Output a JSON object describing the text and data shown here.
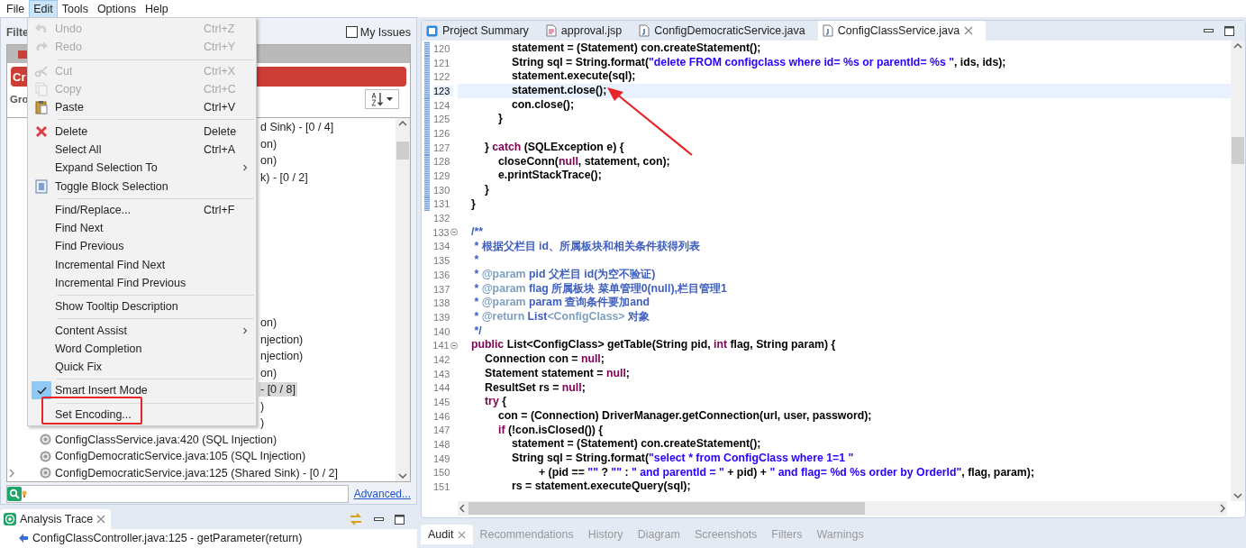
{
  "menubar": [
    {
      "label": "File",
      "selected": false
    },
    {
      "label": "Edit",
      "selected": true
    },
    {
      "label": "Tools",
      "selected": false
    },
    {
      "label": "Options",
      "selected": false
    },
    {
      "label": "Help",
      "selected": false
    }
  ],
  "menu": {
    "items": [
      {
        "kind": "undo",
        "label": "Undo",
        "shortcut": "Ctrl+Z",
        "submenu": false,
        "disabled": true,
        "checked": false
      },
      {
        "kind": "redo",
        "label": "Redo",
        "shortcut": "Ctrl+Y",
        "submenu": false,
        "disabled": true,
        "checked": false
      },
      {
        "kind": "separator"
      },
      {
        "kind": "cut",
        "label": "Cut",
        "shortcut": "Ctrl+X",
        "submenu": false,
        "disabled": true,
        "checked": false
      },
      {
        "kind": "copy",
        "label": "Copy",
        "shortcut": "Ctrl+C",
        "submenu": false,
        "disabled": true,
        "checked": false
      },
      {
        "kind": "paste",
        "label": "Paste",
        "shortcut": "Ctrl+V",
        "submenu": false,
        "disabled": false,
        "checked": false
      },
      {
        "kind": "separator"
      },
      {
        "kind": "delete",
        "label": "Delete",
        "shortcut": "Delete",
        "submenu": false,
        "disabled": false,
        "checked": false
      },
      {
        "kind": "plain",
        "label": "Select All",
        "shortcut": "Ctrl+A",
        "submenu": false,
        "disabled": false,
        "checked": false
      },
      {
        "kind": "plain",
        "label": "Expand Selection To",
        "submenu": true,
        "disabled": false,
        "checked": false
      },
      {
        "kind": "block",
        "label": "Toggle Block Selection",
        "submenu": false,
        "disabled": false,
        "checked": false
      },
      {
        "kind": "separator"
      },
      {
        "kind": "plain",
        "label": "Find/Replace...",
        "shortcut": "Ctrl+F",
        "submenu": false,
        "disabled": false,
        "checked": false
      },
      {
        "kind": "plain",
        "label": "Find Next",
        "submenu": false,
        "disabled": false,
        "checked": false
      },
      {
        "kind": "plain",
        "label": "Find Previous",
        "submenu": false,
        "disabled": false,
        "checked": false
      },
      {
        "kind": "plain",
        "label": "Incremental Find Next",
        "submenu": false,
        "disabled": false,
        "checked": false
      },
      {
        "kind": "plain",
        "label": "Incremental Find Previous",
        "submenu": false,
        "disabled": false,
        "checked": false
      },
      {
        "kind": "separator"
      },
      {
        "kind": "plain",
        "label": "Show Tooltip Description",
        "submenu": false,
        "disabled": false,
        "checked": false
      },
      {
        "kind": "separator"
      },
      {
        "kind": "plain",
        "label": "Content Assist",
        "submenu": true,
        "disabled": false,
        "checked": false
      },
      {
        "kind": "plain",
        "label": "Word Completion",
        "submenu": false,
        "disabled": false,
        "checked": false
      },
      {
        "kind": "plain",
        "label": "Quick Fix",
        "submenu": false,
        "disabled": false,
        "checked": false
      },
      {
        "kind": "separator"
      },
      {
        "kind": "plain",
        "label": "Smart Insert Mode",
        "submenu": false,
        "disabled": false,
        "checked": true
      },
      {
        "kind": "separator"
      },
      {
        "kind": "plain",
        "label": "Set Encoding...",
        "submenu": false,
        "disabled": false,
        "checked": false
      }
    ]
  },
  "issues_panel": {
    "filter_label": "Filte",
    "my_issues": {
      "label": "My Issues",
      "checked": false
    },
    "category_label": "Cr",
    "group_label": "Gro",
    "row_fragments": [
      {
        "text": "d Sink) - [0 / 4]",
        "selected": false
      },
      {
        "text": "on)",
        "selected": false
      },
      {
        "text": "on)",
        "selected": false
      },
      {
        "text": "k) - [0 / 2]",
        "selected": false
      },
      {
        "text": "on)",
        "selected": false
      },
      {
        "text": "njection)",
        "selected": false
      },
      {
        "text": "njection)",
        "selected": false
      },
      {
        "text": "on)",
        "selected": false
      },
      {
        "text": "- [0 / 8]",
        "selected": true
      },
      {
        "text": ")",
        "selected": false
      },
      {
        "text": ")",
        "selected": false
      }
    ],
    "rows": [
      {
        "text": "ConfigClassService.java:420 (SQL Injection)",
        "selected": false,
        "expandable": false
      },
      {
        "text": "ConfigDemocraticService.java:105 (SQL Injection)",
        "selected": false,
        "expandable": false
      },
      {
        "text": "ConfigDemocraticService.java:125 (Shared Sink) - [0 / 2]",
        "selected": false,
        "expandable": true
      }
    ],
    "advanced_link": "Advanced..."
  },
  "analysis_trace": {
    "title": "Analysis Trace",
    "rows": [
      "ConfigClassController.java:125 - getParameter(return)"
    ]
  },
  "editor": {
    "tabs": [
      {
        "kind": "summary",
        "label": "Project Summary",
        "selected": false
      },
      {
        "kind": "jsp",
        "label": "approval.jsp",
        "selected": false
      },
      {
        "kind": "java",
        "label": "ConfigDemocraticService.java",
        "selected": false
      },
      {
        "kind": "java",
        "label": "ConfigClassService.java",
        "selected": true
      }
    ],
    "lines": [
      {
        "number": "120",
        "changed": true,
        "current": false,
        "foldable": false,
        "segments": [
          {
            "kind": "code",
            "text": "\t\t\tstatement = (Statement) con.createStatement();"
          }
        ]
      },
      {
        "number": "121",
        "changed": true,
        "current": false,
        "foldable": false,
        "segments": [
          {
            "kind": "code",
            "text": "\t\t\tString sql = String.format("
          },
          {
            "kind": "string",
            "text": "\"delete FROM configclass where id= %s or parentId= %s \""
          },
          {
            "kind": "code",
            "text": ", ids, ids);"
          }
        ]
      },
      {
        "number": "122",
        "changed": true,
        "current": false,
        "foldable": false,
        "segments": [
          {
            "kind": "code",
            "text": "\t\t\tstatement.execute(sql);"
          }
        ]
      },
      {
        "number": "123",
        "changed": true,
        "current": true,
        "foldable": false,
        "segments": [
          {
            "kind": "code",
            "text": "\t\t\tstatement.close();"
          }
        ]
      },
      {
        "number": "124",
        "changed": true,
        "current": false,
        "foldable": false,
        "segments": [
          {
            "kind": "code",
            "text": "\t\t\tcon.close();"
          }
        ]
      },
      {
        "number": "125",
        "changed": true,
        "current": false,
        "foldable": false,
        "segments": [
          {
            "kind": "code",
            "text": "\t\t}"
          }
        ]
      },
      {
        "number": "126",
        "changed": true,
        "current": false,
        "foldable": false
      },
      {
        "number": "127",
        "changed": true,
        "current": false,
        "foldable": false,
        "segments": [
          {
            "kind": "code",
            "text": "\t} "
          },
          {
            "kind": "keyword",
            "text": "catch"
          },
          {
            "kind": "code",
            "text": " (SQLException e) {"
          }
        ]
      },
      {
        "number": "128",
        "changed": true,
        "current": false,
        "foldable": false,
        "segments": [
          {
            "kind": "code",
            "text": "\t\tcloseConn("
          },
          {
            "kind": "keyword",
            "text": "null"
          },
          {
            "kind": "code",
            "text": ", statement, con);"
          }
        ]
      },
      {
        "number": "129",
        "changed": true,
        "current": false,
        "foldable": false,
        "segments": [
          {
            "kind": "code",
            "text": "\t\te.printStackTrace();"
          }
        ]
      },
      {
        "number": "130",
        "changed": true,
        "current": false,
        "foldable": false,
        "segments": [
          {
            "kind": "code",
            "text": "\t}"
          }
        ]
      },
      {
        "number": "131",
        "changed": true,
        "current": false,
        "foldable": false,
        "segments": [
          {
            "kind": "code",
            "text": "}"
          }
        ]
      },
      {
        "number": "132",
        "changed": false,
        "current": false,
        "foldable": false
      },
      {
        "number": "133",
        "changed": false,
        "current": false,
        "foldable": true,
        "segments": [
          {
            "kind": "doc",
            "text": "/**"
          }
        ]
      },
      {
        "number": "134",
        "changed": false,
        "current": false,
        "foldable": false,
        "segments": [
          {
            "kind": "doc",
            "text": " * 根据父栏目 id、所属板块和相关条件获得列表"
          }
        ]
      },
      {
        "number": "135",
        "changed": false,
        "current": false,
        "foldable": false,
        "segments": [
          {
            "kind": "doc",
            "text": " *"
          }
        ]
      },
      {
        "number": "136",
        "changed": false,
        "current": false,
        "foldable": false,
        "segments": [
          {
            "kind": "doc",
            "text": " * "
          },
          {
            "kind": "doctag",
            "text": "@param"
          },
          {
            "kind": "doc",
            "text": " pid 父栏目 id(为空不验证)"
          }
        ]
      },
      {
        "number": "137",
        "changed": false,
        "current": false,
        "foldable": false,
        "segments": [
          {
            "kind": "doc",
            "text": " * "
          },
          {
            "kind": "doctag",
            "text": "@param"
          },
          {
            "kind": "doc",
            "text": " flag 所属板块 菜单管理0(null),栏目管理1"
          }
        ]
      },
      {
        "number": "138",
        "changed": false,
        "current": false,
        "foldable": false,
        "segments": [
          {
            "kind": "doc",
            "text": " * "
          },
          {
            "kind": "doctag",
            "text": "@param"
          },
          {
            "kind": "doc",
            "text": " param 查询条件要加and"
          }
        ]
      },
      {
        "number": "139",
        "changed": false,
        "current": false,
        "foldable": false,
        "segments": [
          {
            "kind": "doc",
            "text": " * "
          },
          {
            "kind": "doctag",
            "text": "@return"
          },
          {
            "kind": "doc",
            "text": " List"
          },
          {
            "kind": "doctag",
            "text": "<ConfigClass>"
          },
          {
            "kind": "doc",
            "text": " 对象"
          }
        ]
      },
      {
        "number": "140",
        "changed": false,
        "current": false,
        "foldable": false,
        "segments": [
          {
            "kind": "doc",
            "text": " */"
          }
        ]
      },
      {
        "number": "141",
        "changed": false,
        "current": false,
        "foldable": true,
        "segments": [
          {
            "kind": "keyword",
            "text": "public"
          },
          {
            "kind": "code",
            "text": " List<ConfigClass> getTable(String pid, "
          },
          {
            "kind": "keyword",
            "text": "int"
          },
          {
            "kind": "code",
            "text": " flag, String param) {"
          }
        ]
      },
      {
        "number": "142",
        "changed": false,
        "current": false,
        "foldable": false,
        "segments": [
          {
            "kind": "code",
            "text": "\tConnection con = "
          },
          {
            "kind": "keyword",
            "text": "null"
          },
          {
            "kind": "code",
            "text": ";"
          }
        ]
      },
      {
        "number": "143",
        "changed": false,
        "current": false,
        "foldable": false,
        "segments": [
          {
            "kind": "code",
            "text": "\tStatement statement = "
          },
          {
            "kind": "keyword",
            "text": "null"
          },
          {
            "kind": "code",
            "text": ";"
          }
        ]
      },
      {
        "number": "144",
        "changed": false,
        "current": false,
        "foldable": false,
        "segments": [
          {
            "kind": "code",
            "text": "\tResultSet rs = "
          },
          {
            "kind": "keyword",
            "text": "null"
          },
          {
            "kind": "code",
            "text": ";"
          }
        ]
      },
      {
        "number": "145",
        "changed": false,
        "current": false,
        "foldable": false,
        "segments": [
          {
            "kind": "keyword",
            "text": "\ttry"
          },
          {
            "kind": "code",
            "text": " {"
          }
        ]
      },
      {
        "number": "146",
        "changed": false,
        "current": false,
        "foldable": false,
        "segments": [
          {
            "kind": "code",
            "text": "\t\tcon = (Connection) DriverManager.getConnection(url, user, password);"
          }
        ]
      },
      {
        "number": "147",
        "changed": false,
        "current": false,
        "foldable": false,
        "segments": [
          {
            "kind": "keyword",
            "text": "\t\tif"
          },
          {
            "kind": "code",
            "text": " (!con.isClosed()) {"
          }
        ]
      },
      {
        "number": "148",
        "changed": false,
        "current": false,
        "foldable": false,
        "segments": [
          {
            "kind": "code",
            "text": "\t\t\tstatement = (Statement) con.createStatement();"
          }
        ]
      },
      {
        "number": "149",
        "changed": false,
        "current": false,
        "foldable": false,
        "segments": [
          {
            "kind": "code",
            "text": "\t\t\tString sql = String.format("
          },
          {
            "kind": "string",
            "text": "\"select * from ConfigClass where 1=1 \""
          }
        ]
      },
      {
        "number": "150",
        "changed": false,
        "current": false,
        "foldable": false,
        "segments": [
          {
            "kind": "code",
            "text": "\t\t\t\t\t+ (pid == "
          },
          {
            "kind": "string",
            "text": "\"\""
          },
          {
            "kind": "code",
            "text": " ? "
          },
          {
            "kind": "string",
            "text": "\"\""
          },
          {
            "kind": "code",
            "text": " : "
          },
          {
            "kind": "string",
            "text": "\" and parentId = \""
          },
          {
            "kind": "code",
            "text": " + pid) + "
          },
          {
            "kind": "string",
            "text": "\" and flag= %d %s order by OrderId\""
          },
          {
            "kind": "code",
            "text": ", flag, param);"
          }
        ]
      },
      {
        "number": "151",
        "changed": false,
        "current": false,
        "foldable": false,
        "segments": [
          {
            "kind": "code",
            "text": "\t\t\trs = statement.executeQuery(sql);"
          }
        ]
      }
    ]
  },
  "bottom_tabs": [
    {
      "label": "Audit",
      "selected": true
    },
    {
      "label": "Recommendations",
      "selected": false
    },
    {
      "label": "History",
      "selected": false
    },
    {
      "label": "Diagram",
      "selected": false
    },
    {
      "label": "Screenshots",
      "selected": false
    },
    {
      "label": "Filters",
      "selected": false
    },
    {
      "label": "Warnings",
      "selected": false
    }
  ]
}
